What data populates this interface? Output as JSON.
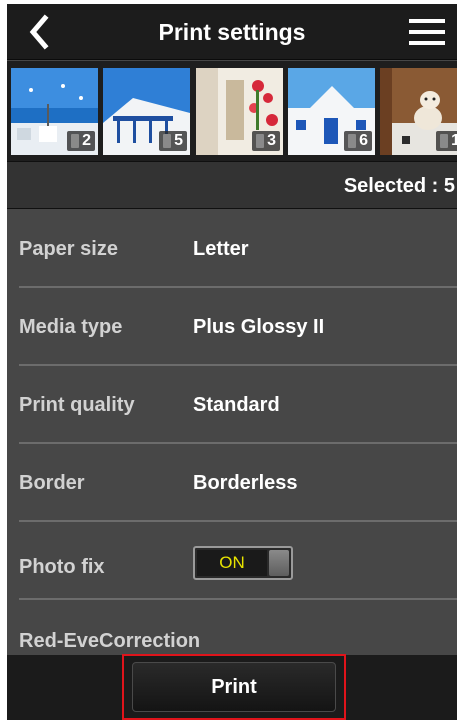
{
  "header": {
    "title": "Print settings",
    "back_icon": "chevron-left-icon",
    "menu_icon": "hamburger-menu-icon"
  },
  "thumbnails": [
    {
      "number": "2",
      "scene": "blue sky with windmills over white buildings"
    },
    {
      "number": "5",
      "scene": "blue sky over white building with blue railings"
    },
    {
      "number": "3",
      "scene": "white alley with red flowers"
    },
    {
      "number": "6",
      "scene": "white chapel with blue door"
    },
    {
      "number": "1",
      "scene": "dog lying on a patterned floor"
    }
  ],
  "selected": {
    "text": "Selected : 5"
  },
  "settings": [
    {
      "label": "Paper size",
      "value": "Letter"
    },
    {
      "label": "Media type",
      "value": "Plus Glossy II"
    },
    {
      "label": "Print quality",
      "value": "Standard"
    },
    {
      "label": "Border",
      "value": "Borderless"
    },
    {
      "label": "Photo fix",
      "toggle": "ON"
    },
    {
      "label": "Red-EveCorrection"
    }
  ],
  "footer": {
    "print_label": "Print"
  },
  "colors": {
    "header_bg": "#1c1c1c",
    "panel_bg": "#474747",
    "toggle_text": "#e8e400",
    "highlight_border": "#e0141b"
  }
}
